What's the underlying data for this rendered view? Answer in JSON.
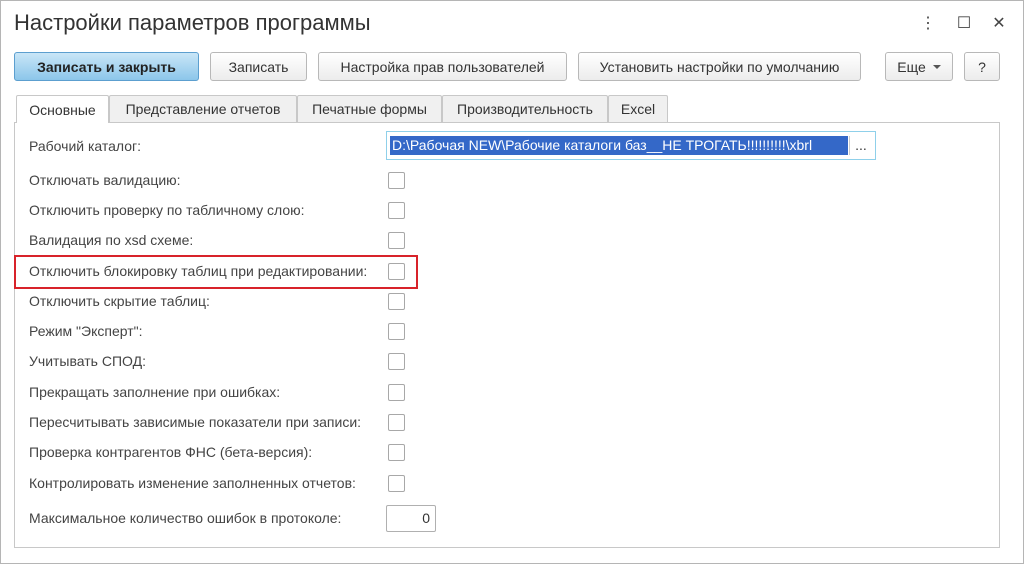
{
  "window": {
    "title": "Настройки параметров программы",
    "controls": {
      "menu": "⋮",
      "maximize": "☐",
      "close": "✕"
    }
  },
  "toolbar": {
    "save_close": "Записать и закрыть",
    "save": "Записать",
    "user_rights": "Настройка прав пользователей",
    "defaults": "Установить настройки по умолчанию",
    "more": "Еще",
    "help": "?"
  },
  "tabs": [
    "Основные",
    "Представление отчетов",
    "Печатные формы",
    "Производительность",
    "Excel"
  ],
  "active_tab": "Основные",
  "form": {
    "catalog_label": "Рабочий каталог:",
    "catalog_value": "D:\\Рабочая NEW\\Рабочие каталоги баз__НЕ ТРОГАТЬ!!!!!!!!!!\\xbrl",
    "catalog_button": "...",
    "checkboxes": [
      {
        "label": "Отключать валидацию:",
        "checked": false
      },
      {
        "label": "Отключить проверку по табличному слою:",
        "checked": false
      },
      {
        "label": "Валидация по xsd схеме:",
        "checked": false
      },
      {
        "label": "Отключить блокировку таблиц при редактировании:",
        "checked": false
      },
      {
        "label": "Отключить скрытие таблиц:",
        "checked": false
      },
      {
        "label": "Режим \"Эксперт\":",
        "checked": false
      },
      {
        "label": "Учитывать СПОД:",
        "checked": false
      },
      {
        "label": "Прекращать заполнение при ошибках:",
        "checked": false
      },
      {
        "label": "Пересчитывать зависимые показатели при записи:",
        "checked": false
      },
      {
        "label": "Проверка контрагентов ФНС (бета-версия):",
        "checked": false
      },
      {
        "label": "Контролировать изменение заполненных отчетов:",
        "checked": false
      }
    ],
    "max_errors_label": "Максимальное количество ошибок в протоколе:",
    "max_errors_value": "0"
  },
  "colors": {
    "accent": "#8cc6ea",
    "selection": "#3468c8",
    "highlight_frame": "#d8232a"
  }
}
